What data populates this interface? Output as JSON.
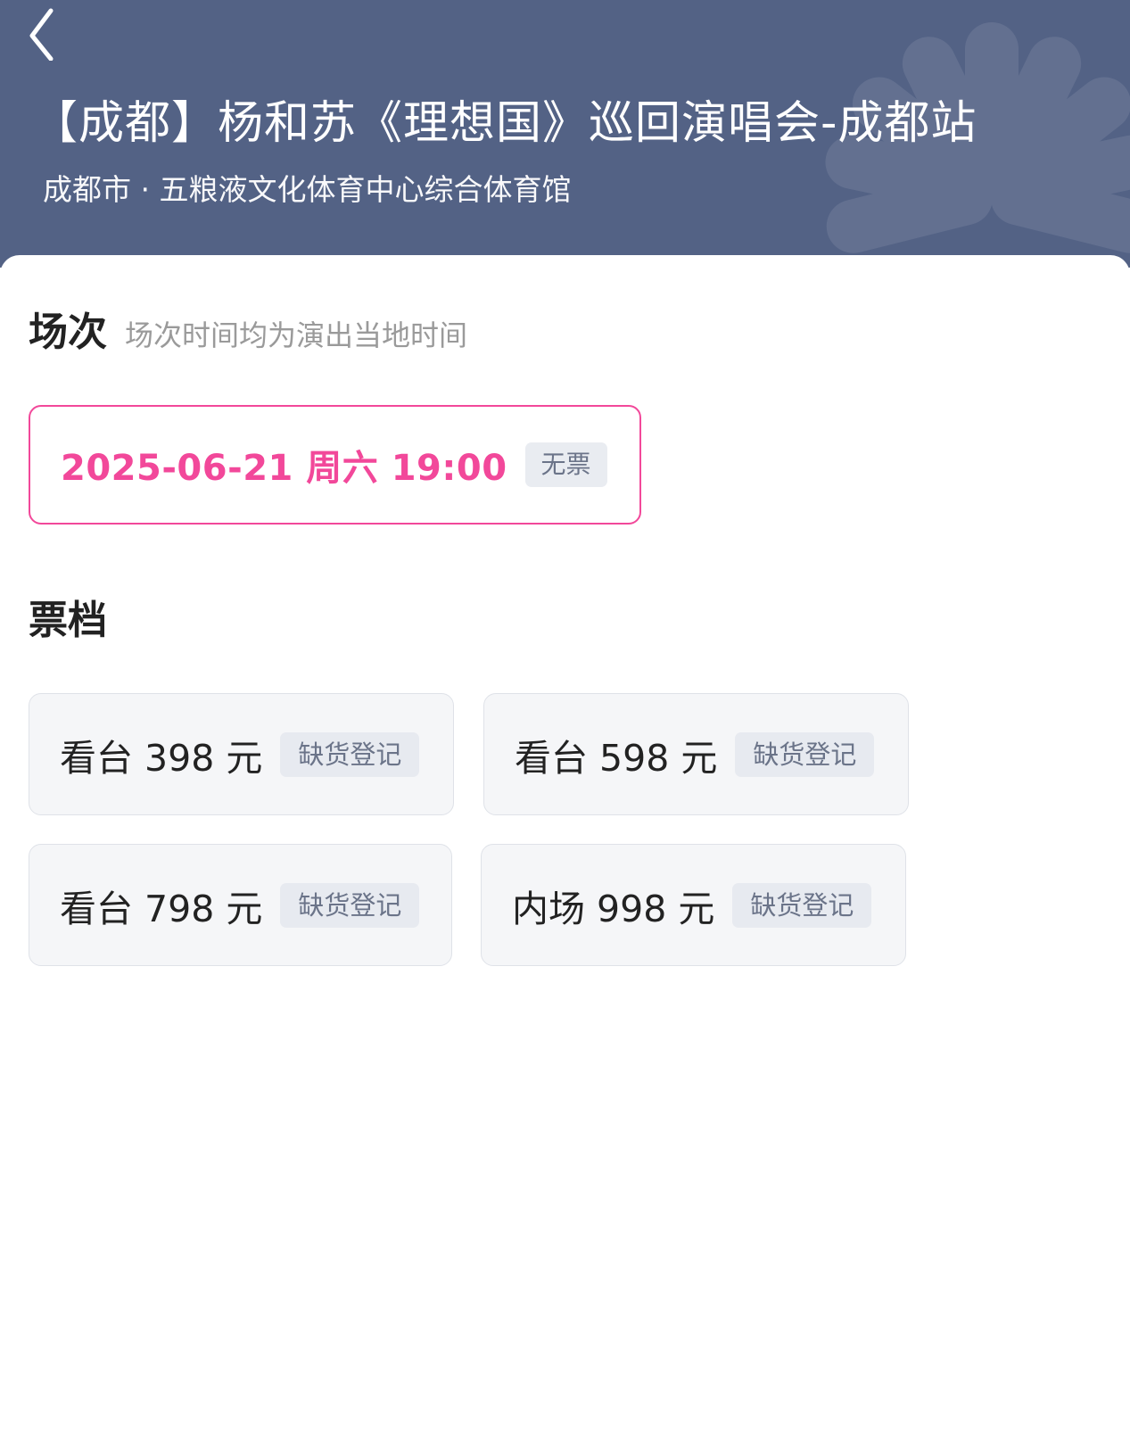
{
  "header": {
    "title": "【成都】杨和苏《理想国》巡回演唱会-成都站",
    "venue": "成都市 · 五粮液文化体育中心综合体育馆"
  },
  "sessions": {
    "title": "场次",
    "hint": "场次时间均为演出当地时间",
    "items": [
      {
        "datetime": "2025-06-21  周六 19:00",
        "status": "无票"
      }
    ]
  },
  "tiers": {
    "title": "票档",
    "items": [
      {
        "label": "看台 398 元",
        "status": "缺货登记"
      },
      {
        "label": "看台 598 元",
        "status": "缺货登记"
      },
      {
        "label": "看台 798 元",
        "status": "缺货登记"
      },
      {
        "label": "内场 998 元",
        "status": "缺货登记"
      }
    ]
  },
  "colors": {
    "header_bg": "#536285",
    "accent_pink": "#f2489a",
    "tier_card_bg": "#f5f6f8",
    "badge_bg": "#e7eaf0",
    "badge_text": "#6b7489"
  },
  "icons": {
    "back": "chevron-left-icon",
    "header_decoration": "flower-decoration-icon"
  }
}
